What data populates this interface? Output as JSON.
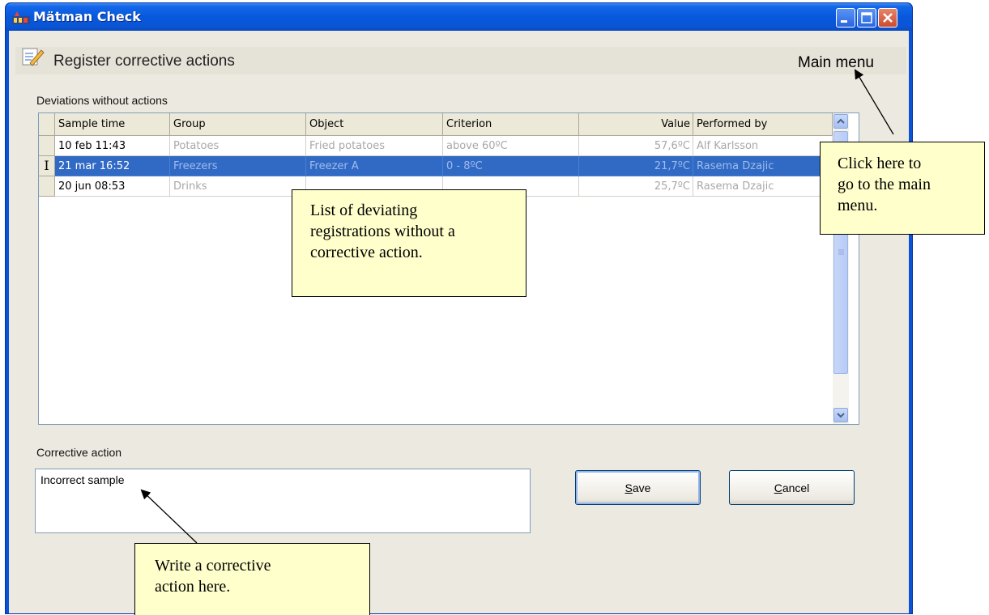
{
  "window": {
    "title": "Mätman Check"
  },
  "header": {
    "title": "Register corrective actions",
    "main_menu": "Main menu"
  },
  "deviations": {
    "label": "Deviations without actions",
    "columns": [
      "Sample time",
      "Group",
      "Object",
      "Criterion",
      "Value",
      "Performed by"
    ],
    "rows": [
      {
        "sample_time": "10 feb 11:43",
        "group": "Potatoes",
        "object": "Fried potatoes",
        "criterion": "above 60ºC",
        "value": "57,6ºC",
        "performed_by": "Alf Karlsson",
        "selected": false
      },
      {
        "sample_time": "21 mar 16:52",
        "group": "Freezers",
        "object": "Freezer A",
        "criterion": "0 - 8ºC",
        "value": "21,7ºC",
        "performed_by": "Rasema Dzajic",
        "selected": true
      },
      {
        "sample_time": "20 jun 08:53",
        "group": "Drinks",
        "object": "",
        "criterion": "",
        "value": "25,7ºC",
        "performed_by": "Rasema Dzajic",
        "selected": false
      }
    ],
    "row_marker": "I"
  },
  "corrective_action": {
    "label": "Corrective action",
    "value": "Incorrect sample"
  },
  "buttons": {
    "save": "Save",
    "cancel": "Cancel"
  },
  "callouts": {
    "main_menu": "Click here to\ngo to the main\nmenu.",
    "list": "List of deviating\nregistrations without a\ncorrective action.",
    "action": "Write a corrective\naction here."
  },
  "icons": {
    "app": "app-logo-icon",
    "header": "edit-note-icon",
    "minimize": "minimize-icon",
    "maximize": "maximize-icon",
    "close": "close-icon",
    "scroll_up": "arrow-up-icon",
    "scroll_down": "arrow-down-icon"
  },
  "colors": {
    "titlebar": "#0858dc",
    "selection": "#316ac5",
    "callout_bg": "#ffffcc"
  }
}
